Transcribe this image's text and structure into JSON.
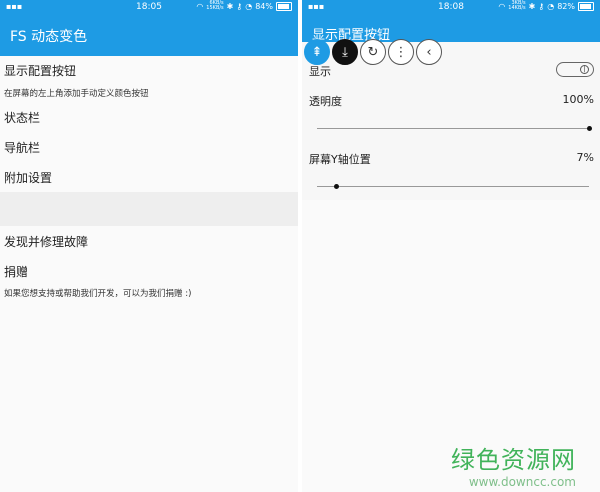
{
  "left": {
    "status": {
      "time": "18:05",
      "net_up": "6KB/s",
      "net_down": "15KB/s",
      "battery": "84%"
    },
    "appbar_title": "FS 动态变色",
    "items": [
      {
        "label": "显示配置按钮"
      },
      {
        "label": "状态栏"
      },
      {
        "label": "导航栏"
      },
      {
        "label": "附加设置"
      },
      {
        "label": "发现并修理故障"
      },
      {
        "label": "捐赠"
      }
    ],
    "show_config_desc": "在屏幕的左上角添加手动定义颜色按钮",
    "donate_desc": "如果您想支持或帮助我们开发，可以为我们捐赠 :)"
  },
  "right": {
    "status": {
      "time": "18:08",
      "net_up": "3KB/s",
      "net_down": "14KB/s",
      "battery": "82%"
    },
    "appbar_title": "显示配置按钮",
    "show_label": "显示",
    "opacity_label": "透明度",
    "opacity_value": "100%",
    "y_position_label": "屏幕Y轴位置",
    "y_position_value": "7%",
    "opacity_fraction": 1.0,
    "y_position_fraction": 0.07,
    "toggle_on": true
  },
  "watermark": {
    "logo": "绿色资源网",
    "url": "www.downcc.com"
  }
}
